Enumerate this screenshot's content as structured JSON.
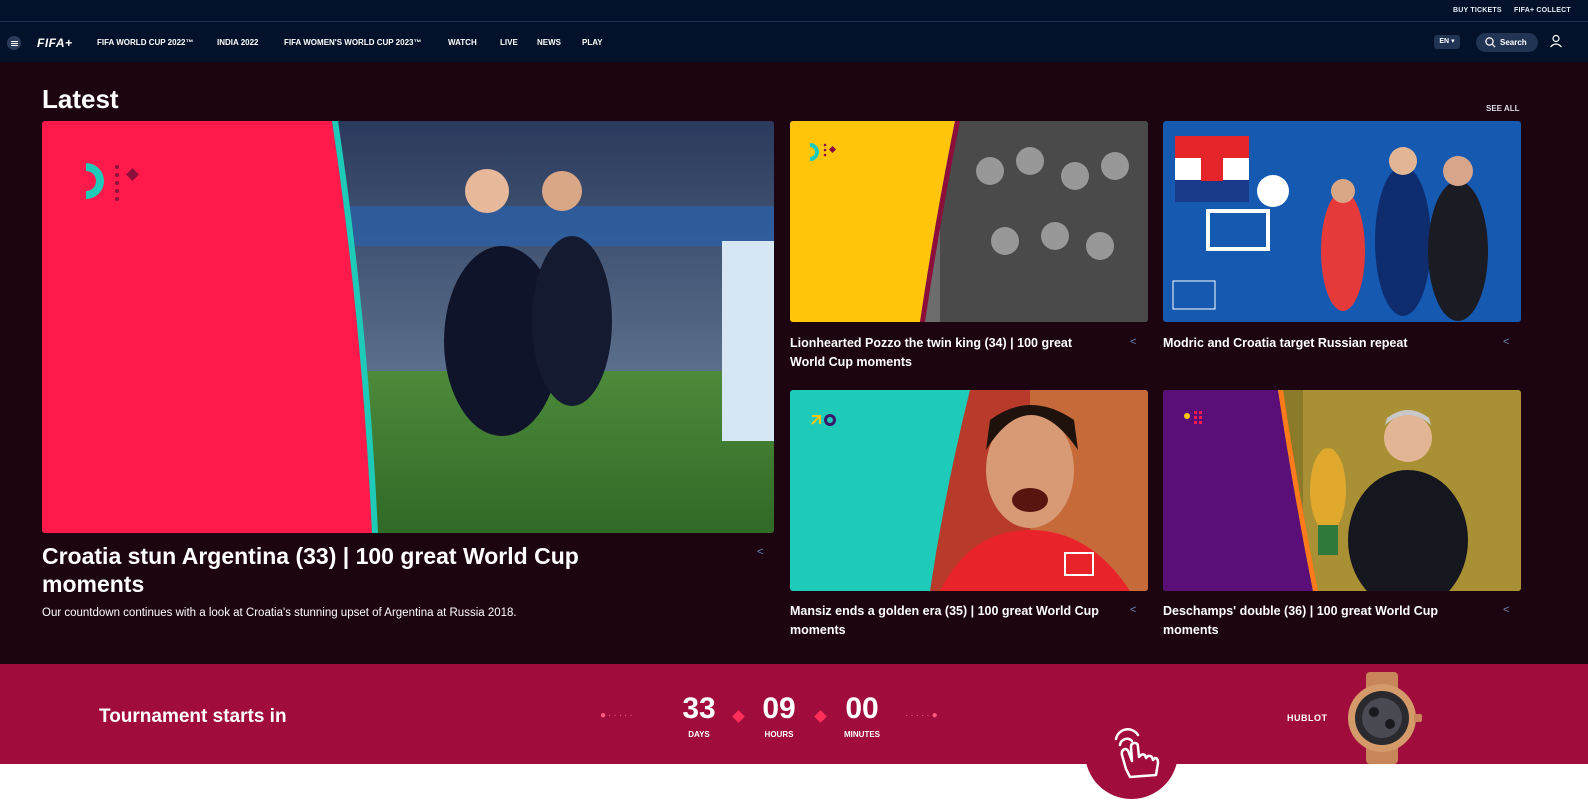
{
  "top_util": {
    "buy_tickets": "BUY TICKETS",
    "fifa_plus_collect": "FIFA+ COLLECT"
  },
  "nav": {
    "logo": "FIFA+",
    "links": [
      "FIFA WORLD CUP 2022™",
      "INDIA 2022",
      "FIFA WOMEN'S WORLD CUP 2023™",
      "WATCH",
      "LIVE",
      "NEWS",
      "PLAY"
    ],
    "lang": "EN",
    "search_label": "Search"
  },
  "latest": {
    "heading": "Latest",
    "see_all": "SEE ALL",
    "hero": {
      "title": "Croatia stun Argentina (33) | 100 great World Cup moments",
      "description": "Our countdown continues with a look at Croatia's stunning upset of Argentina at Russia 2018."
    },
    "cards": [
      {
        "title": "Lionhearted Pozzo the twin king (34) | 100 great World Cup moments"
      },
      {
        "title": "Modric and Croatia target Russian repeat"
      },
      {
        "title": "Mansiz ends a golden era (35) | 100 great World Cup moments"
      },
      {
        "title": "Deschamps' double (36) | 100 great World Cup moments"
      }
    ]
  },
  "countdown": {
    "label": "Tournament starts in",
    "days": "33",
    "days_label": "DAYS",
    "hours": "09",
    "hours_label": "HOURS",
    "minutes": "00",
    "minutes_label": "MINUTES",
    "sponsor": "HUBLOT"
  },
  "colors": {
    "nav_bg": "#03122a",
    "section_bg": "#1c0511",
    "countdown_bg": "#a00c3c",
    "accent_pink": "#ff1a4b",
    "accent_teal": "#1ecbb8"
  }
}
